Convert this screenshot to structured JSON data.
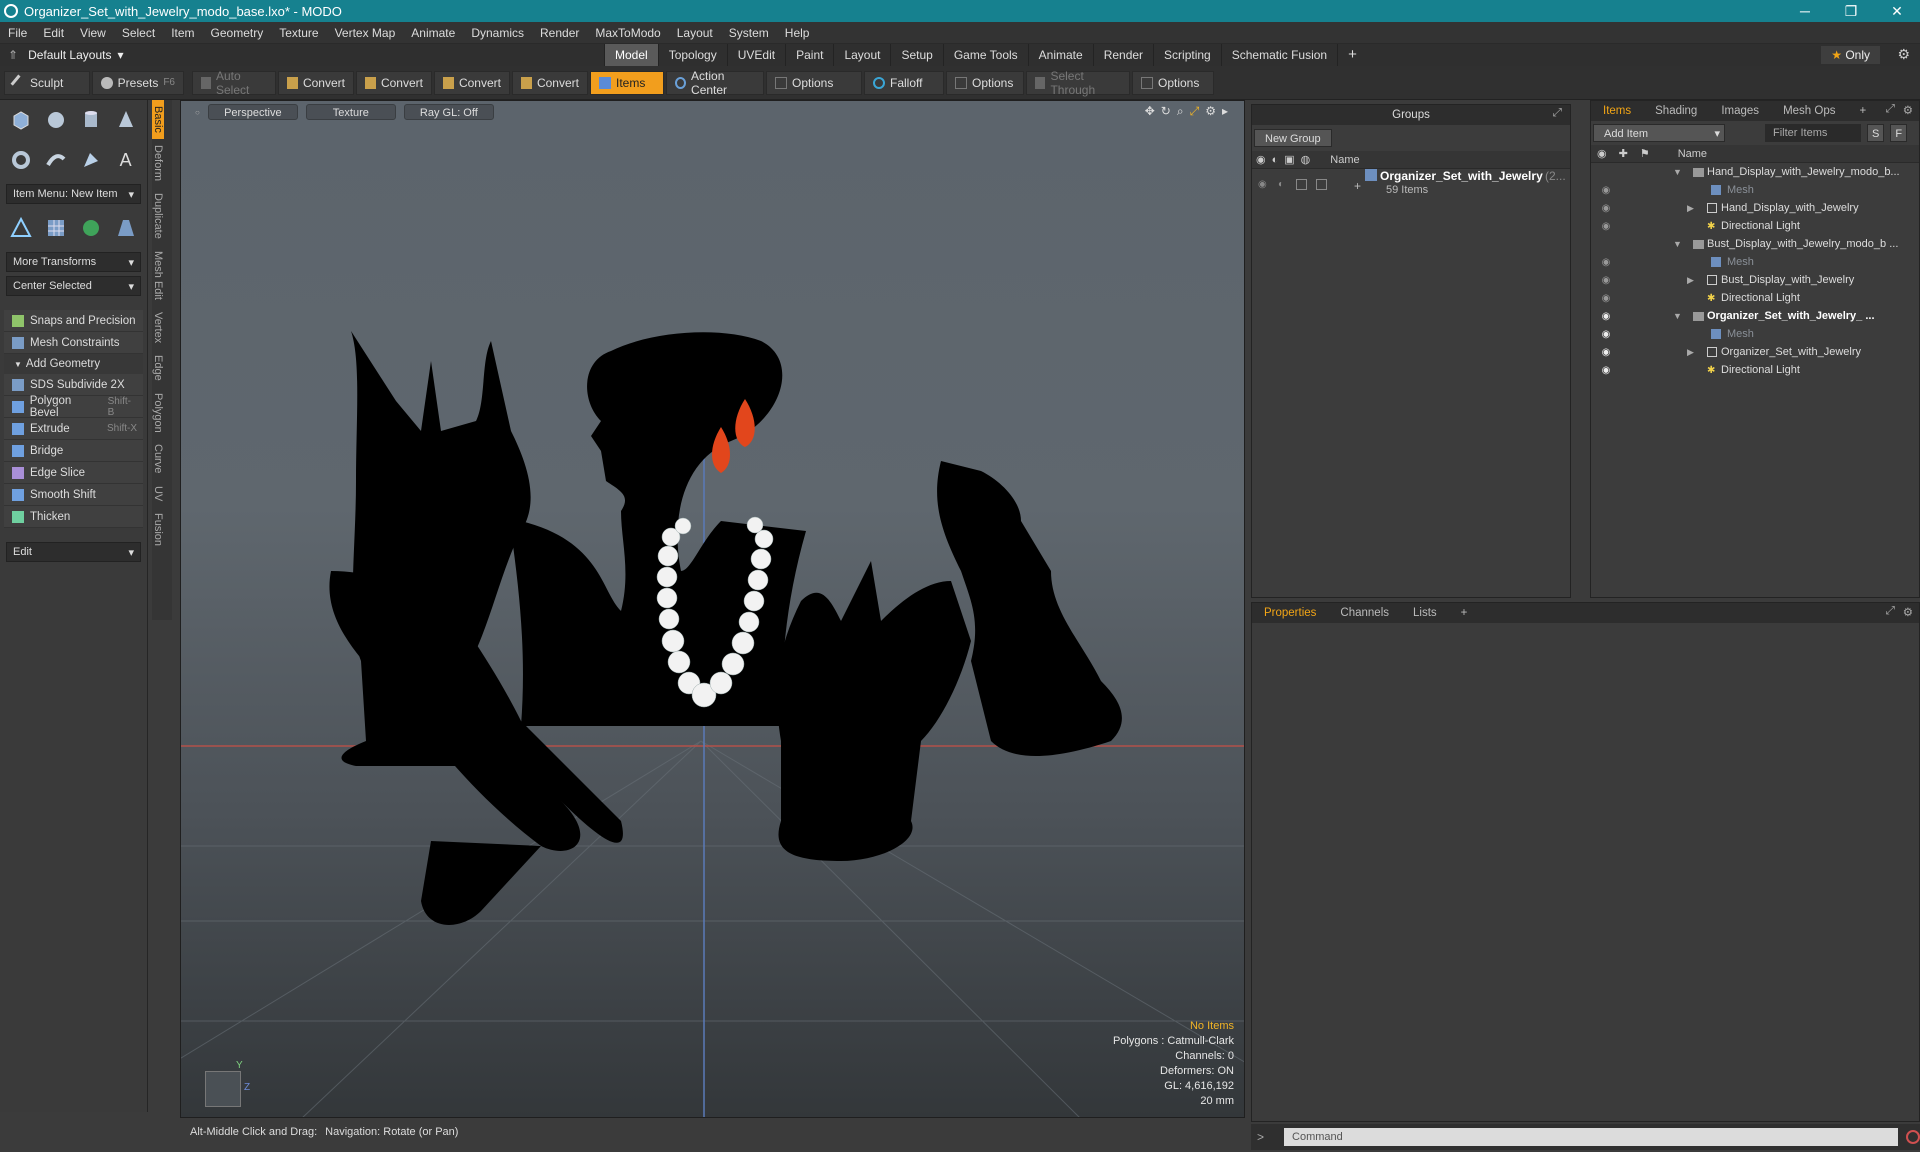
{
  "window": {
    "title": "Organizer_Set_with_Jewelry_modo_base.lxo* - MODO",
    "minimize": "─",
    "restore": "❐",
    "close": "✕"
  },
  "menu": [
    "File",
    "Edit",
    "View",
    "Select",
    "Item",
    "Geometry",
    "Texture",
    "Vertex Map",
    "Animate",
    "Dynamics",
    "Render",
    "MaxToModo",
    "Layout",
    "System",
    "Help"
  ],
  "layouts": {
    "current": "Default Layouts",
    "tabs": [
      "Model",
      "Topology",
      "UVEdit",
      "Paint",
      "Layout",
      "Setup",
      "Game Tools",
      "Animate",
      "Render",
      "Scripting",
      "Schematic Fusion"
    ],
    "active": "Model",
    "add": "+",
    "only": "Only"
  },
  "toolbar": {
    "sculpt": "Sculpt",
    "presets": "Presets",
    "presets_key": "F6",
    "auto_select": "Auto Select",
    "convert1": "Convert",
    "convert2": "Convert",
    "convert3": "Convert",
    "convert4": "Convert",
    "items": "Items",
    "action_center": "Action Center",
    "options1": "Options",
    "falloff": "Falloff",
    "options2": "Options",
    "select_through": "Select Through",
    "options3": "Options"
  },
  "vtabs": [
    "Basic",
    "Deform",
    "Duplicate",
    "Mesh Edit",
    "Vertex",
    "Edge",
    "Polygon",
    "Curve",
    "UV",
    "Fusion"
  ],
  "left": {
    "item_menu": "Item Menu: New Item",
    "more_transforms": "More Transforms",
    "center_selected": "Center Selected",
    "snaps": "Snaps and Precision",
    "constraints": "Mesh Constraints",
    "add_geometry": "Add Geometry",
    "tools": [
      {
        "label": "SDS Subdivide 2X",
        "key": ""
      },
      {
        "label": "Polygon Bevel",
        "key": "Shift-B"
      },
      {
        "label": "Extrude",
        "key": "Shift-X"
      },
      {
        "label": "Bridge",
        "key": ""
      },
      {
        "label": "Edge Slice",
        "key": ""
      },
      {
        "label": "Smooth Shift",
        "key": ""
      },
      {
        "label": "Thicken",
        "key": ""
      }
    ],
    "edit": "Edit"
  },
  "viewport": {
    "view": "Perspective",
    "shading": "Texture",
    "raygl": "Ray GL: Off",
    "info": {
      "selection": "No Items",
      "polygons": "Polygons : Catmull-Clark",
      "channels": "Channels: 0",
      "deformers": "Deformers: ON",
      "gl": "GL: 4,616,192",
      "scale": "20 mm"
    },
    "axis_y": "Y",
    "axis_z": "Z"
  },
  "status": {
    "hint": "Alt-Middle Click and Drag:",
    "action": "Navigation: Rotate (or Pan)"
  },
  "groups": {
    "title": "Groups",
    "new_group": "New Group",
    "col_name": "Name",
    "entry": "Organizer_Set_with_Jewelry",
    "entry_count": "(2...",
    "entry_sub": "59 Items"
  },
  "items": {
    "tabs": [
      "Items",
      "Shading",
      "Images",
      "Mesh Ops"
    ],
    "add_item": "Add Item",
    "filter": "Filter Items",
    "s": "S",
    "f": "F",
    "col_name": "Name",
    "tree": [
      {
        "label": "Hand_Display_with_Jewelry_modo_b...",
        "level": 0,
        "kind": "scene"
      },
      {
        "label": "Mesh",
        "level": 1,
        "kind": "mesh"
      },
      {
        "label": "Hand_Display_with_Jewelry",
        "level": 1,
        "kind": "group"
      },
      {
        "label": "Directional Light",
        "level": 1,
        "kind": "light"
      },
      {
        "label": "Bust_Display_with_Jewelry_modo_b ...",
        "level": 0,
        "kind": "scene"
      },
      {
        "label": "Mesh",
        "level": 1,
        "kind": "mesh"
      },
      {
        "label": "Bust_Display_with_Jewelry",
        "level": 1,
        "kind": "group"
      },
      {
        "label": "Directional Light",
        "level": 1,
        "kind": "light"
      },
      {
        "label": "Organizer_Set_with_Jewelry_ ...",
        "level": 0,
        "kind": "scene"
      },
      {
        "label": "Mesh",
        "level": 1,
        "kind": "mesh"
      },
      {
        "label": "Organizer_Set_with_Jewelry",
        "level": 1,
        "kind": "group"
      },
      {
        "label": "Directional Light",
        "level": 1,
        "kind": "light"
      }
    ]
  },
  "props": {
    "tabs": [
      "Properties",
      "Channels",
      "Lists"
    ],
    "add": "+"
  },
  "command": {
    "placeholder": "Command",
    "prompt": ">"
  },
  "colors": {
    "accent": "#f29e1d",
    "titlebar": "#16818f",
    "earring": "#e2461c"
  }
}
